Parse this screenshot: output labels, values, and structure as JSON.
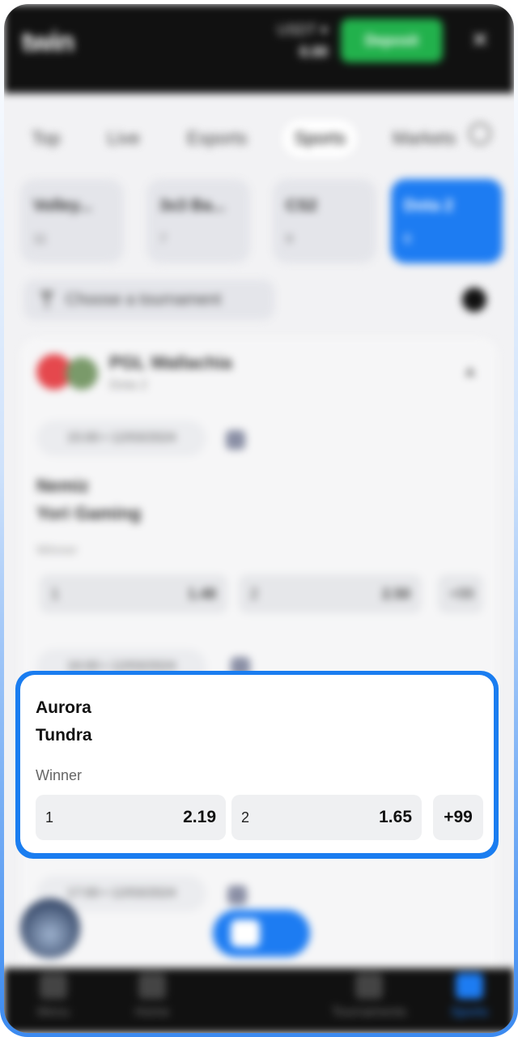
{
  "header": {
    "logo": "twin",
    "currency": "USDT ▾",
    "balance": "0.00",
    "deposit_label": "Deposit"
  },
  "tabs": [
    "Top",
    "Live",
    "Esports",
    "Sports",
    "Markets"
  ],
  "categories": [
    {
      "name": "Volley...",
      "count": "11"
    },
    {
      "name": "3x3 Ba...",
      "count": "7"
    },
    {
      "name": "CS2",
      "count": "9"
    },
    {
      "name": "Dota 2",
      "count": "6"
    }
  ],
  "filter": {
    "label": "Choose a tournament"
  },
  "league": {
    "name": "PGL Wallachia",
    "sub": "Dota 2"
  },
  "blurred_matches": [
    {
      "time": "15:00 • 12/03/2024",
      "team1": "Nemiz",
      "team2": "Yori Gaming",
      "market": "Winner",
      "odd1_label": "1",
      "odd1_value": "1.48",
      "odd2_label": "2",
      "odd2_value": "2.50",
      "more": "+99"
    },
    {
      "time": "16:00 • 12/03/2024"
    },
    {
      "time": "17:00 • 12/03/2024"
    }
  ],
  "highlight": {
    "team1": "Aurora",
    "team2": "Tundra",
    "market": "Winner",
    "odd1_label": "1",
    "odd1_value": "2.19",
    "odd2_label": "2",
    "odd2_value": "1.65",
    "more": "+99"
  },
  "bottom_nav": [
    {
      "label": "Menu",
      "icon": "menu-icon"
    },
    {
      "label": "Home",
      "icon": "home-icon"
    },
    {
      "label": "Tournaments",
      "icon": "trophy-icon"
    },
    {
      "label": "Sports",
      "icon": "sports-icon"
    }
  ],
  "colors": {
    "accent": "#1d7cf2",
    "deposit": "#22b14c",
    "topbar": "#111111"
  }
}
